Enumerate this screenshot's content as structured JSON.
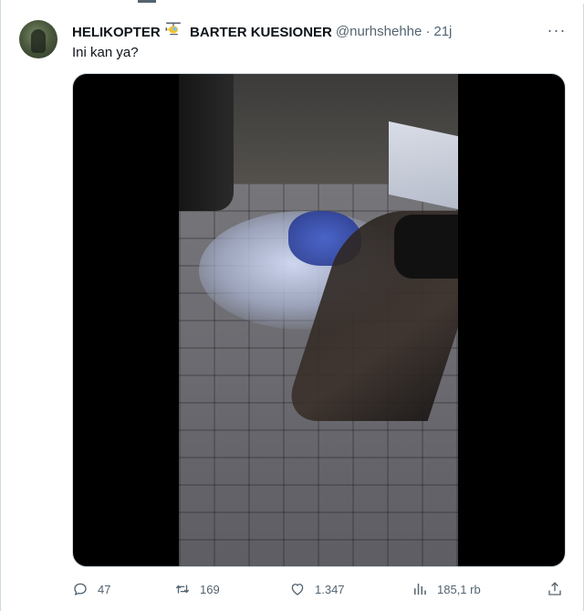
{
  "tweet": {
    "author_name_part1": "HELIKOPTER",
    "author_name_part2": "BARTER KUESIONER",
    "handle": "@nurhshehhe",
    "separator": "·",
    "time": "21j",
    "text": "Ini kan ya?",
    "more_label": "···",
    "name_emoji_icon": "helicopter-emoji",
    "media_type": "video"
  },
  "actions": {
    "replies": "47",
    "reposts": "169",
    "likes": "1.347",
    "views": "185,1 rb"
  },
  "colors": {
    "text": "#0f1419",
    "secondary": "#536471",
    "border": "#cfd9de",
    "media_background": "#000000"
  }
}
